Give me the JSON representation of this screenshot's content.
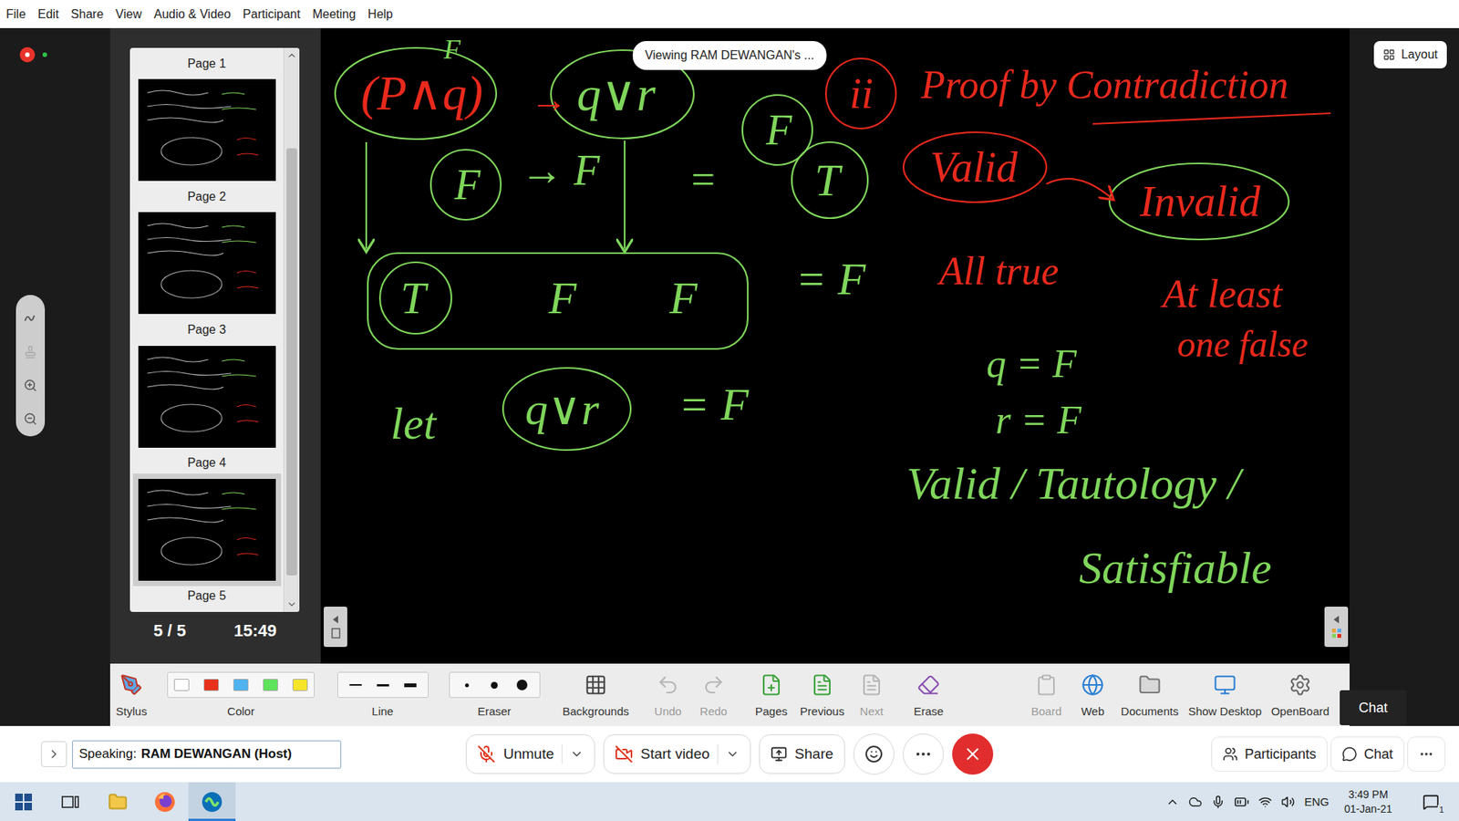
{
  "menu": [
    "File",
    "Edit",
    "Share",
    "View",
    "Audio & Video",
    "Participant",
    "Meeting",
    "Help"
  ],
  "status": {
    "recording": true,
    "connected": true
  },
  "viewing_banner": "Viewing RAM DEWANGAN's ...",
  "layout_button": "Layout",
  "pages": [
    {
      "label": "Page 1",
      "thumbnail_shown": false,
      "selected": false
    },
    {
      "label": "Page 2",
      "thumbnail_shown": true,
      "selected": false
    },
    {
      "label": "Page 3",
      "thumbnail_shown": true,
      "selected": false
    },
    {
      "label": "Page 4",
      "thumbnail_shown": true,
      "selected": false
    },
    {
      "label": "Page 5",
      "thumbnail_shown": true,
      "selected": true
    }
  ],
  "page_scroll": {
    "start": 0.16,
    "size": 0.8
  },
  "page_counter": "5 / 5",
  "clock": "15:49",
  "board": {
    "notes": [
      {
        "text": "(P∧q)",
        "color": "#e8291c"
      },
      {
        "text": "F",
        "color": "#7fd65b"
      },
      {
        "text": "→",
        "color": "#e8291c"
      },
      {
        "text": "q∨r",
        "color": "#7fd65b"
      },
      {
        "text": "F",
        "color": "#7fd65b"
      },
      {
        "text": "ii",
        "color": "#e8291c"
      },
      {
        "text": "Proof by Contradiction",
        "color": "#e8291c"
      },
      {
        "text": "F",
        "color": "#7fd65b"
      },
      {
        "text": "→ F",
        "color": "#7fd65b"
      },
      {
        "text": "=",
        "color": "#7fd65b"
      },
      {
        "text": "T",
        "color": "#7fd65b"
      },
      {
        "text": "T",
        "color": "#7fd65b"
      },
      {
        "text": "F",
        "color": "#7fd65b"
      },
      {
        "text": "F",
        "color": "#7fd65b"
      },
      {
        "text": "= F",
        "color": "#7fd65b"
      },
      {
        "text": "Valid",
        "color": "#e8291c"
      },
      {
        "text": "Invalid",
        "color": "#e8291c"
      },
      {
        "text": "All true",
        "color": "#e8291c"
      },
      {
        "text": "At least",
        "color": "#e8291c"
      },
      {
        "text": "one false",
        "color": "#e8291c"
      },
      {
        "text": "q = F",
        "color": "#7fd65b"
      },
      {
        "text": "r = F",
        "color": "#7fd65b"
      },
      {
        "text": "let",
        "color": "#7fd65b"
      },
      {
        "text": "q∨r",
        "color": "#7fd65b"
      },
      {
        "text": "= F",
        "color": "#7fd65b"
      },
      {
        "text": "Valid / Tautology /",
        "color": "#7fd65b"
      },
      {
        "text": "Satisfiable",
        "color": "#7fd65b"
      }
    ]
  },
  "toolbar": {
    "tools": [
      {
        "label": "Stylus",
        "kind": "tool",
        "disabled": false
      },
      {
        "label": "Color",
        "kind": "swatches",
        "options": [
          {
            "color": "#ffffff",
            "selected": false
          },
          {
            "color": "#e8311a",
            "selected": false
          },
          {
            "color": "#4fb3f0",
            "selected": false
          },
          {
            "color": "#5ee35a",
            "selected": false
          },
          {
            "color": "#f5e42a",
            "selected": false
          }
        ]
      },
      {
        "label": "Line",
        "kind": "widths",
        "options": [
          {
            "selected": false
          },
          {
            "selected": false
          },
          {
            "selected": false
          }
        ]
      },
      {
        "label": "Eraser",
        "kind": "sizes",
        "options": [
          {
            "selected": false
          },
          {
            "selected": false
          },
          {
            "selected": false
          }
        ]
      },
      {
        "label": "Backgrounds",
        "kind": "tool",
        "disabled": false
      },
      {
        "label": "Undo",
        "kind": "tool",
        "disabled": true
      },
      {
        "label": "Redo",
        "kind": "tool",
        "disabled": true
      },
      {
        "label": "Pages",
        "kind": "tool",
        "disabled": false
      },
      {
        "label": "Previous",
        "kind": "tool",
        "disabled": false
      },
      {
        "label": "Next",
        "kind": "tool",
        "disabled": true
      },
      {
        "label": "Erase",
        "kind": "tool",
        "disabled": false
      },
      {
        "label": "Board",
        "kind": "tool",
        "disabled": true
      },
      {
        "label": "Web",
        "kind": "tool",
        "disabled": false
      },
      {
        "label": "Documents",
        "kind": "tool",
        "disabled": false
      },
      {
        "label": "Show Desktop",
        "kind": "tool",
        "disabled": false
      },
      {
        "label": "OpenBoard",
        "kind": "tool",
        "disabled": false
      }
    ]
  },
  "chat_tooltip": "Chat",
  "speaking": {
    "label": "Speaking:",
    "name": "RAM DEWANGAN (Host)"
  },
  "controls": {
    "audio": {
      "label": "Unmute",
      "muted": true
    },
    "video": {
      "label": "Start video",
      "off": true
    },
    "share": {
      "label": "Share"
    }
  },
  "right_controls": [
    {
      "label": "Participants"
    },
    {
      "label": "Chat"
    }
  ],
  "taskbar": {
    "apps": [
      {
        "active": false
      },
      {
        "active": false
      },
      {
        "active": false
      },
      {
        "active": false
      },
      {
        "active": true
      }
    ],
    "language": "ENG",
    "time": "3:49 PM",
    "date": "01-Jan-21",
    "notifications": "1"
  }
}
